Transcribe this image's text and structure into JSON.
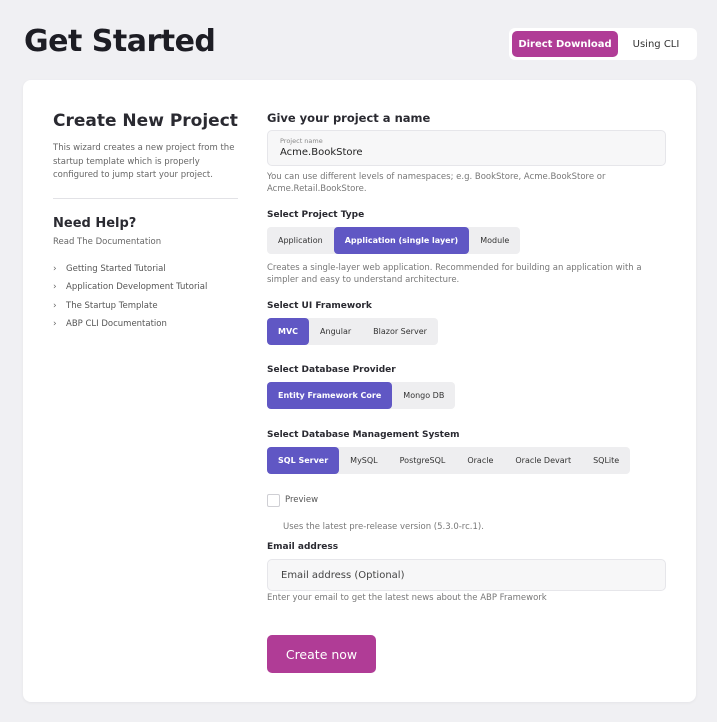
{
  "header": {
    "title": "Get Started",
    "tabs": [
      {
        "label": "Direct Download",
        "active": true
      },
      {
        "label": "Using CLI",
        "active": false
      }
    ]
  },
  "sidebar": {
    "title": "Create New Project",
    "description": "This wizard creates a new project from the startup template which is properly configured to jump start your project.",
    "help_title": "Need Help?",
    "help_subtitle": "Read The Documentation",
    "links": [
      "Getting Started Tutorial",
      "Application Development Tutorial",
      "The Startup Template",
      "ABP CLI Documentation"
    ]
  },
  "form": {
    "name_heading": "Give your project a name",
    "name_label": "Project name",
    "name_value": "Acme.BookStore",
    "name_help": "You can use different levels of namespaces; e.g. BookStore, Acme.BookStore or Acme.Retail.BookStore.",
    "project_type": {
      "heading": "Select Project Type",
      "options": [
        "Application",
        "Application (single layer)",
        "Module"
      ],
      "selected": "Application (single layer)",
      "help": "Creates a single-layer web application. Recommended for building an application with a simpler and easy to understand architecture."
    },
    "ui_framework": {
      "heading": "Select UI Framework",
      "options": [
        "MVC",
        "Angular",
        "Blazor Server"
      ],
      "selected": "MVC"
    },
    "db_provider": {
      "heading": "Select Database Provider",
      "options": [
        "Entity Framework Core",
        "Mongo DB"
      ],
      "selected": "Entity Framework Core"
    },
    "dbms": {
      "heading": "Select Database Management System",
      "options": [
        "SQL Server",
        "MySQL",
        "PostgreSQL",
        "Oracle",
        "Oracle Devart",
        "SQLite"
      ],
      "selected": "SQL Server"
    },
    "preview": {
      "label": "Preview",
      "checked": false,
      "help": "Uses the latest pre-release version (5.3.0-rc.1)."
    },
    "email": {
      "heading": "Email address",
      "placeholder": "Email address (Optional)",
      "value": "",
      "help": "Enter your email to get the latest news about the ABP Framework"
    },
    "submit_label": "Create now"
  },
  "colors": {
    "accent_magenta": "#b03c96",
    "accent_purple": "#6057c4"
  }
}
